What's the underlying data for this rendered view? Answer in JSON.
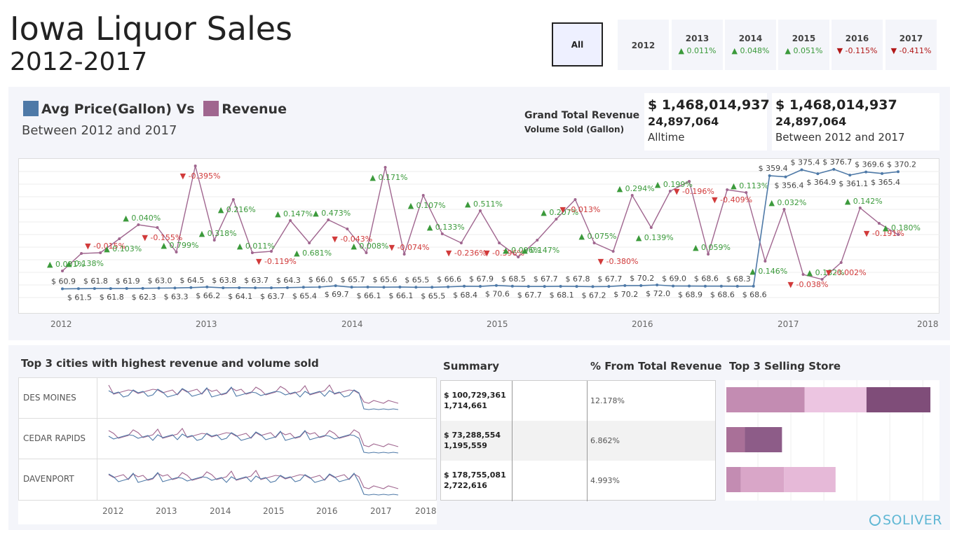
{
  "header": {
    "title_line1": "Iowa Liquor Sales",
    "title_line2": "2012-2017"
  },
  "year_filter": [
    {
      "label": "All",
      "change": "",
      "dir": ""
    },
    {
      "label": "2012",
      "change": "",
      "dir": ""
    },
    {
      "label": "2013",
      "change": "▲ 0.011%",
      "dir": "up"
    },
    {
      "label": "2014",
      "change": "▲ 0.048%",
      "dir": "up"
    },
    {
      "label": "2015",
      "change": "▲ 0.051%",
      "dir": "up"
    },
    {
      "label": "2016",
      "change": "▼ -0.115%",
      "dir": "down"
    },
    {
      "label": "2017",
      "change": "▼ -0.411%",
      "dir": "down"
    }
  ],
  "legend": {
    "series1": "Avg Price(Gallon) Vs",
    "series2": "Revenue",
    "subtitle": "Between 2012 and 2017"
  },
  "grand_total": {
    "label": "Grand Total Revenue",
    "sublabel": "Volume Sold (Gallon)"
  },
  "kpis": [
    {
      "revenue": "$ 1,468,014,937",
      "volume": "24,897,064",
      "caption": "Alltime"
    },
    {
      "revenue": "$ 1,468,014,937",
      "volume": "24,897,064",
      "caption": "Between 2012 and 2017"
    }
  ],
  "colors": {
    "price": "#4e79a7",
    "revenue": "#a0668f",
    "up": "#3b9a3b",
    "down": "#d13a3a",
    "panel": "#f4f5fa"
  },
  "chart_data": [
    {
      "type": "line",
      "x_ticks": [
        "2012",
        "2013",
        "2014",
        "2015",
        "2016",
        "2017",
        "2018"
      ],
      "series": [
        {
          "name": "Avg Price(Gallon)",
          "labels": [
            "$ 60.9",
            "$ 61.5",
            "$ 61.8",
            "$ 61.8",
            "$ 61.9",
            "$ 62.3",
            "$ 63.0",
            "$ 63.3",
            "$ 64.5",
            "$ 66.2",
            "$ 63.8",
            "$ 64.1",
            "$ 63.7",
            "$ 63.7",
            "$ 64.3",
            "$ 65.4",
            "$ 66.0",
            "$ 69.7",
            "$ 65.7",
            "$ 66.1",
            "$ 65.6",
            "$ 66.1",
            "$ 65.5",
            "$ 65.5",
            "$ 66.6",
            "$ 68.4",
            "$ 67.9",
            "$ 70.6",
            "$ 68.5",
            "$ 67.7",
            "$ 67.7",
            "$ 68.1",
            "$ 67.8",
            "$ 67.2",
            "$ 67.7",
            "$ 70.2",
            "$ 70.2",
            "$ 72.0",
            "$ 69.0",
            "$ 68.9",
            "$ 68.6",
            "$ 68.6",
            "$ 68.3",
            "$ 68.6",
            "$ 359.4",
            "$ 356.4",
            "$ 375.4",
            "$ 364.9",
            "$ 376.7",
            "$ 361.1",
            "$ 369.6",
            "$ 365.4",
            "$ 370.2"
          ]
        },
        {
          "name": "Revenue",
          "changes": [
            "▲ 0.001%",
            "▲ 0.138%",
            "▼ -0.015%",
            "▲ 0.103%",
            "▲ 0.040%",
            "▼ -0.155%",
            "▲ 0.799%",
            "▼ -0.395%",
            "▲ 0.318%",
            "▲ 0.216%",
            "▲ 0.011%",
            "▼ -0.119%",
            "▲ 0.147%",
            "▲ 0.681%",
            "▲ 0.473%",
            "▼ -0.043%",
            "▲ 0.008%",
            "▲ 0.171%",
            "▼ -0.074%",
            "▲ 0.107%",
            "▲ 0.133%",
            "▼ -0.236%",
            "▲ 0.511%",
            "▼ -0.396%",
            "▲ 0.096%",
            "▲ 0.147%",
            "▲ 0.207%",
            "▼ -0.013%",
            "▲ 0.075%",
            "▼ -0.380%",
            "▲ 0.294%",
            "▲ 0.139%",
            "▲ 0.199%",
            "▼ -0.196%",
            "▲ 0.059%",
            "▼ -0.409%",
            "▲ 0.113%",
            "▲ 0.146%",
            "▲ 0.032%",
            "▼ -0.038%",
            "▲ 0.182%",
            "▼ -0.002%",
            "▲ 0.142%",
            "▼ -0.191%",
            "▲ 0.180%"
          ]
        }
      ]
    }
  ],
  "cities": {
    "title": "Top 3 cities with highest revenue and volume sold",
    "rows": [
      {
        "name": "DES MOINES",
        "revenue": "$ 100,729,361",
        "volume": "1,714,661",
        "pct": "12.178%"
      },
      {
        "name": "CEDAR RAPIDS",
        "revenue": "$ 73,288,554",
        "volume": "1,195,559",
        "pct": "6.862%"
      },
      {
        "name": "DAVENPORT",
        "revenue": "$ 178,755,081",
        "volume": "2,722,616",
        "pct": "4.993%"
      }
    ],
    "x_ticks": [
      "2012",
      "2013",
      "2014",
      "2015",
      "2016",
      "2017",
      "2018"
    ]
  },
  "summary": {
    "title": "Summary",
    "pct_title": "% From Total Revenue"
  },
  "stores": {
    "title": "Top 3 Selling Store",
    "bars": [
      {
        "segments": [
          {
            "value": 0.38,
            "color": "#c38cb2"
          },
          {
            "value": 0.3,
            "color": "#ecc5e1"
          },
          {
            "value": 0.31,
            "color": "#7f4d79"
          }
        ]
      },
      {
        "segments": [
          {
            "value": 0.09,
            "color": "#a97098"
          },
          {
            "value": 0.18,
            "color": "#8d5c88"
          }
        ]
      },
      {
        "segments": [
          {
            "value": 0.07,
            "color": "#c38cb2"
          },
          {
            "value": 0.21,
            "color": "#d9a6c8"
          },
          {
            "value": 0.25,
            "color": "#e6b9d8"
          }
        ]
      }
    ]
  },
  "logo": {
    "text": "SOLIVER"
  }
}
